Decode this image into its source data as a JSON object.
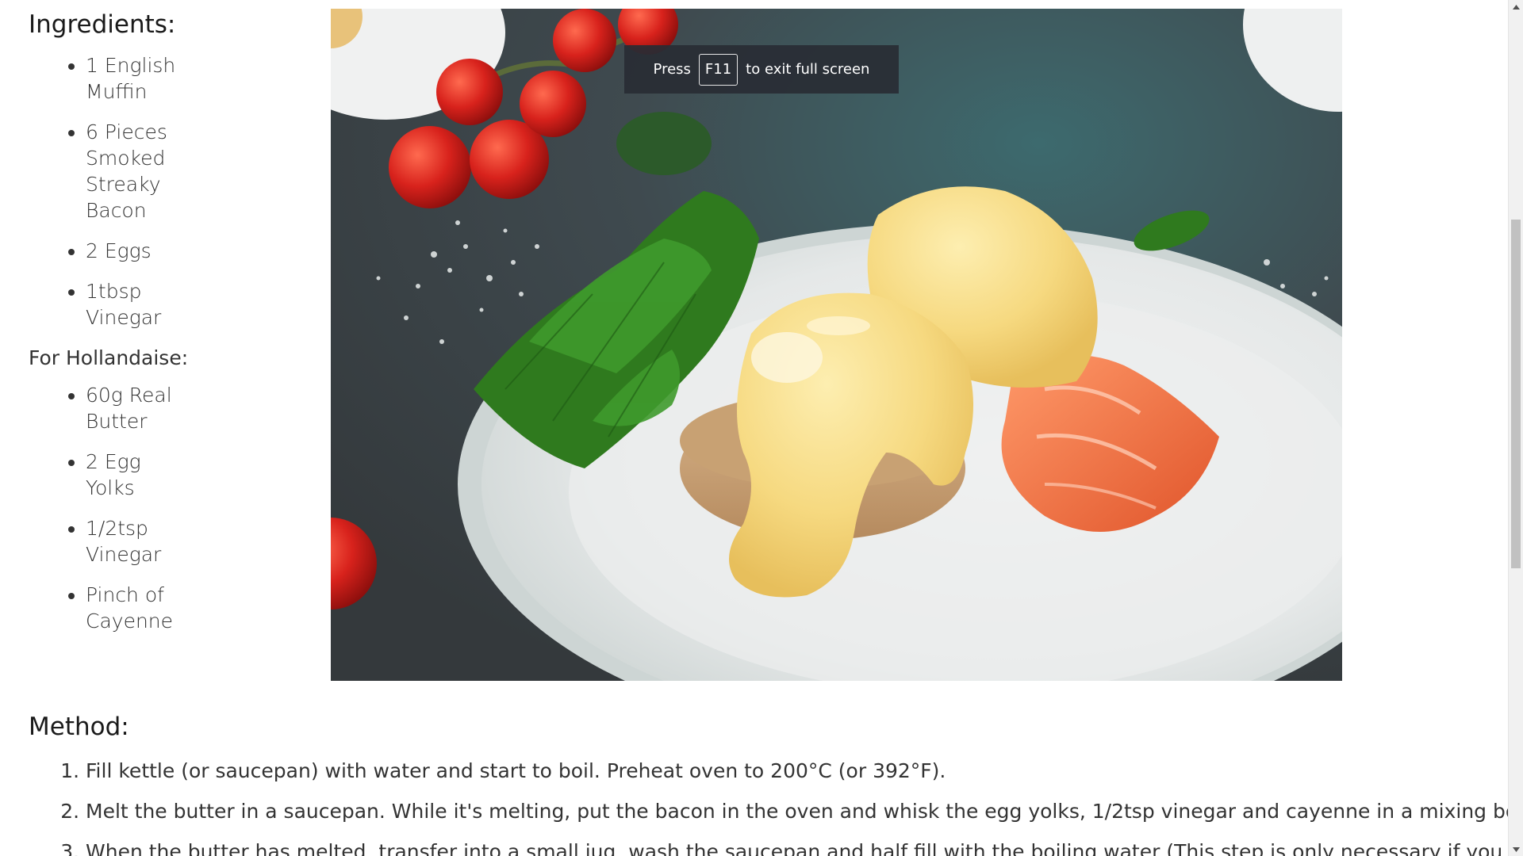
{
  "ingredients": {
    "heading": "Ingredients:",
    "main_items": [
      "1 English Muffin",
      "6 Pieces Smoked Streaky Bacon",
      "2 Eggs",
      "1tbsp Vinegar"
    ],
    "hollandaise_heading": "For Hollandaise:",
    "hollandaise_items": [
      "60g Real Butter",
      "2 Egg Yolks",
      "1/2tsp Vinegar",
      "Pinch of Cayenne"
    ]
  },
  "fullscreen_toast": {
    "prefix": "Press",
    "key": "F11",
    "suffix": "to exit full screen"
  },
  "method": {
    "heading": "Method:",
    "steps": [
      "Fill kettle (or saucepan) with water and start to boil. Preheat oven to 200°C (or 392°F).",
      "Melt the butter in a saucepan. While it's melting, put the bacon in the oven and whisk the egg yolks, 1/2tsp vinegar and cayenne in a mixing bowl.",
      "When the butter has melted, transfer into a small jug, wash the saucepan and half fill with the boiling water (This step is only necessary if you used a"
    ]
  },
  "colors": {
    "toast_bg": "#282c34",
    "hollandaise": "#f7dd88",
    "salmon": "#f07a4a",
    "tomato": "#d8221c",
    "arugula": "#2f7a1e",
    "plate": "#e9ecec",
    "tabletop": "#3b4247"
  },
  "image": {
    "icon": "eggs-benedict-photo"
  },
  "scrollbar": {
    "thumb_position": 0.26
  }
}
